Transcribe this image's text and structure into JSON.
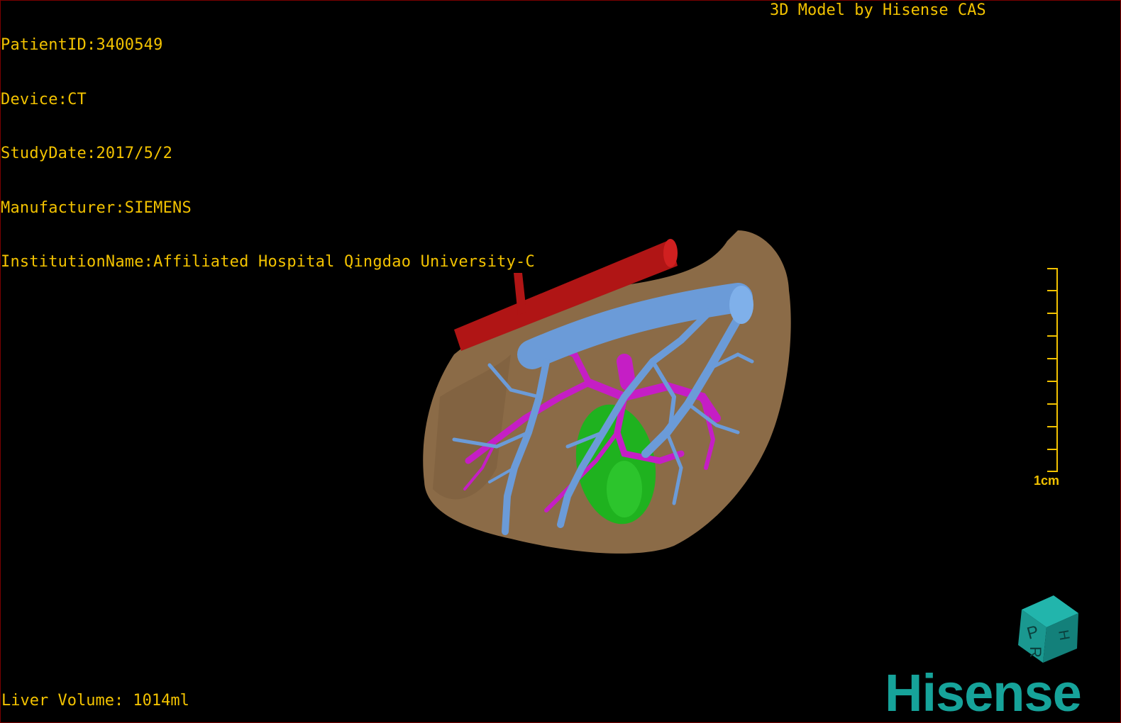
{
  "overlay": {
    "patient_id": "PatientID:3400549",
    "device": "Device:CT",
    "study_date": "StudyDate:2017/5/2",
    "manufacturer": "Manufacturer:SIEMENS",
    "institution": "InstitutionName:Affiliated Hospital Qingdao University-C",
    "model_by": "3D Model by Hisense CAS",
    "liver_volume": "Liver Volume: 1014ml"
  },
  "scale_bar": {
    "label": "1cm"
  },
  "orientation_cube": {
    "face_labels": [
      "P",
      "H",
      "R"
    ]
  },
  "brand": {
    "logo_text": "Hisense"
  },
  "colors": {
    "text": "#f2c200",
    "liver": "#8b6b47",
    "portal_vein": "#6b9bd8",
    "hepatic_artery": "#c51ec5",
    "ivc": "#b01515",
    "gallbladder": "#1fb21f",
    "brand": "#16a39a"
  },
  "icons": {
    "orientation_cube": "orientation-cube-icon"
  }
}
